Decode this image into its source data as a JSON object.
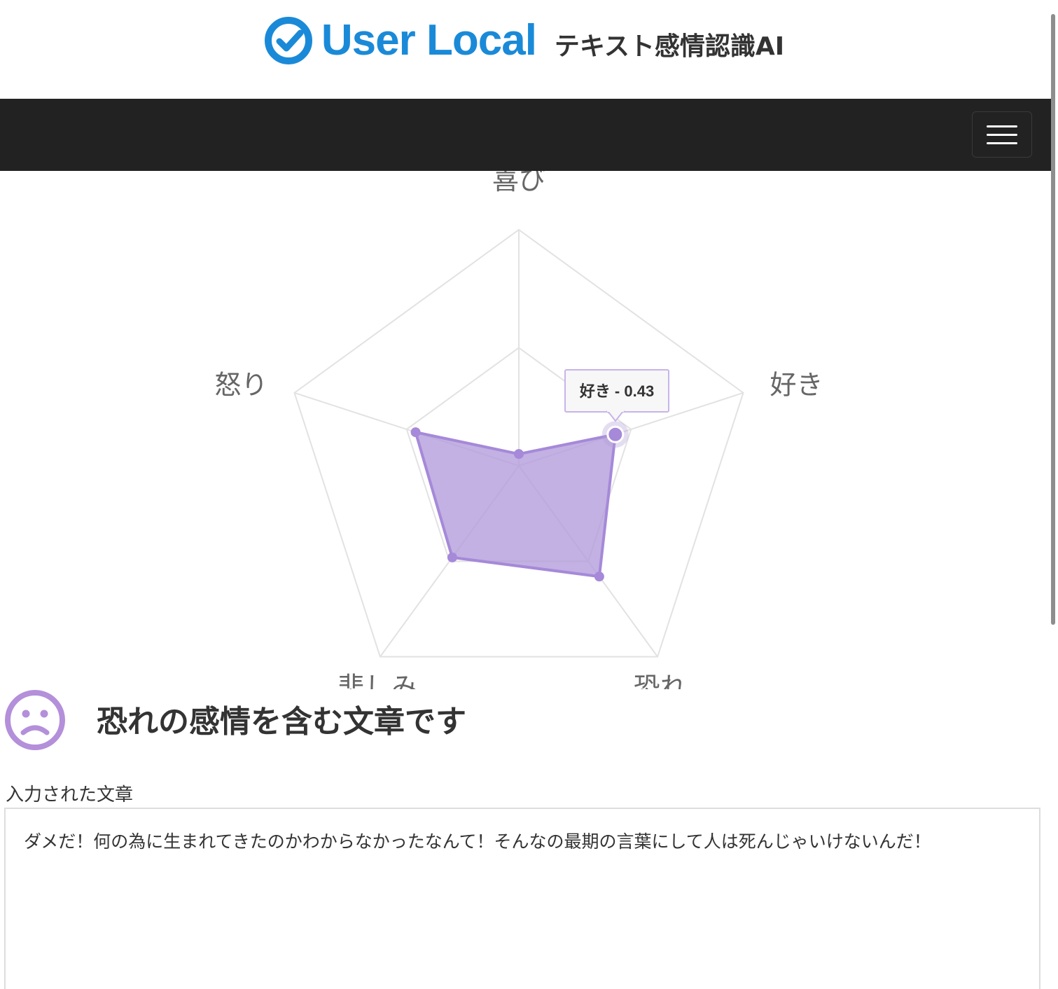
{
  "header": {
    "brand": "User Local",
    "product": "テキスト感情認識AI"
  },
  "navbar": {
    "menu_icon": "hamburger-menu-icon"
  },
  "chart_data": {
    "type": "radar",
    "axes": [
      "喜び",
      "好き",
      "恐れ",
      "悲しみ",
      "怒り"
    ],
    "values": [
      0.05,
      0.43,
      0.58,
      0.48,
      0.46
    ],
    "range": [
      0,
      1
    ],
    "grid_levels": 2,
    "fill_color": "#b39ddb",
    "stroke_color": "#a689d9",
    "tooltip": "好き - 0.43"
  },
  "result": {
    "icon": "sad-face-icon",
    "text": "恐れの感情を含む文章です",
    "color": "#b48fda"
  },
  "input": {
    "label": "入力された文章",
    "value": "ダメだ！何の為に生まれてきたのかわからなかったなんて！そんなの最期の言葉にして人は死んじゃいけないんだ！"
  }
}
